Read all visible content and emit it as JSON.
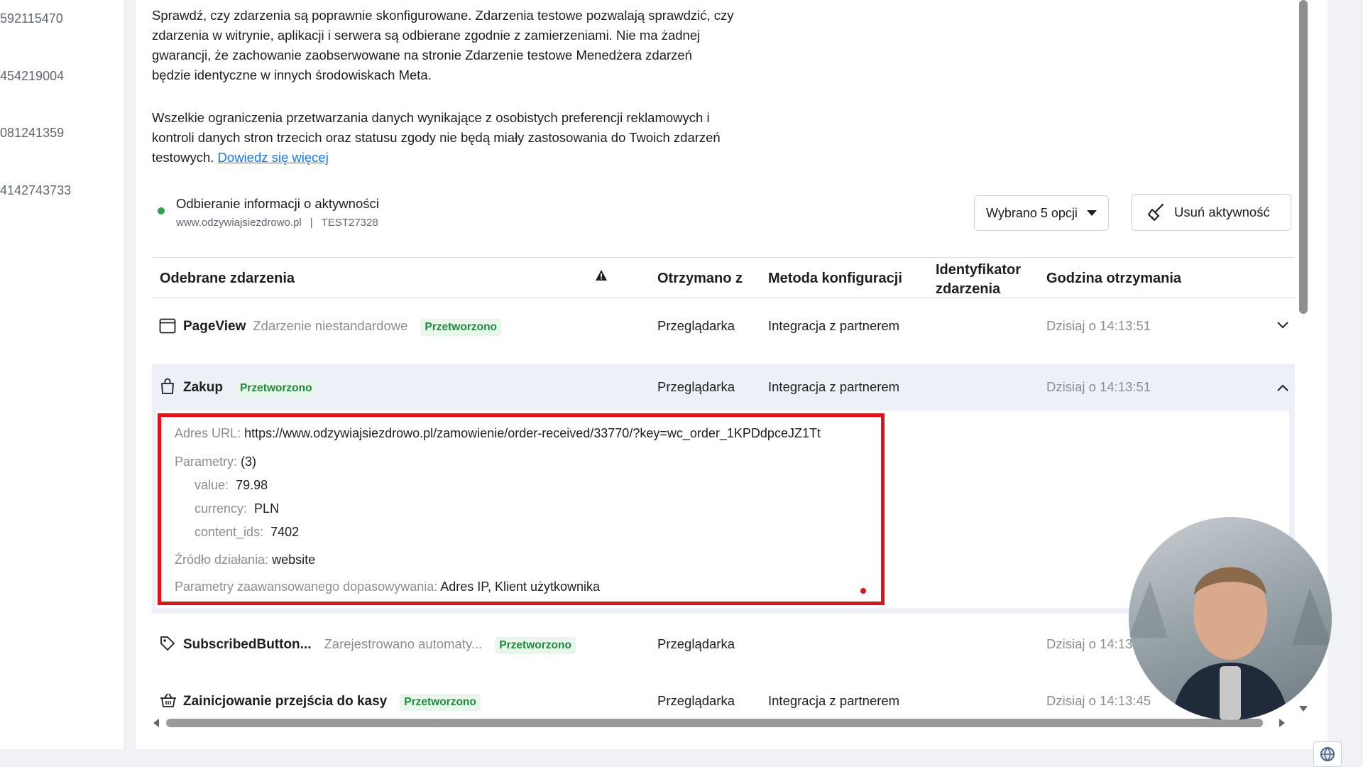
{
  "left_ids": [
    "592115470",
    "454219004",
    "081241359",
    "4142743733"
  ],
  "intro": {
    "para1": "Sprawdź, czy zdarzenia są poprawnie skonfigurowane. Zdarzenia testowe pozwalają sprawdzić, czy zdarzenia w witrynie, aplikacji i serwera są odbierane zgodnie z zamierzeniami. Nie ma żadnej gwarancji, że zachowanie zaobserwowane na stronie Zdarzenie testowe Menedżera zdarzeń będzie identyczne w innych środowiskach Meta.",
    "para2": "Wszelkie ograniczenia przetwarzania danych wynikające z osobistych preferencji reklamowych i kontroli danych stron trzecich oraz statusu zgody nie będą miały zastosowania do Twoich zdarzeń testowych.",
    "learn_more": "Dowiedz się więcej"
  },
  "status": {
    "title": "Odbieranie informacji o aktywności",
    "site": "www.odzywiajsiezdrowo.pl",
    "separator": "|",
    "code": "TEST27328",
    "color": "#31a24c"
  },
  "toolbar": {
    "filter_label": "Wybrano 5 opcji",
    "clear_label": "Usuń aktywność"
  },
  "table": {
    "headers": {
      "events": "Odebrane zdarzenia",
      "received_from": "Otrzymano z",
      "method": "Metoda konfiguracji",
      "event_id_line1": "Identyfikator",
      "event_id_line2": "zdarzenia",
      "time": "Godzina otrzymania"
    },
    "rows": [
      {
        "name": "PageView",
        "desc": "Zdarzenie niestandardowe",
        "status": "Przetworzono",
        "source": "Przeglądarka",
        "method": "Integracja z partnerem",
        "time": "Dzisiaj o 14:13:51",
        "icon": "browser-window-icon"
      },
      {
        "name": "Zakup",
        "desc": "",
        "status": "Przetworzono",
        "source": "Przeglądarka",
        "method": "Integracja z partnerem",
        "time": "Dzisiaj o 14:13:51",
        "icon": "shopping-bag-icon"
      },
      {
        "name": "SubscribedButton...",
        "desc": "Zarejestrowano automaty...",
        "status": "Przetworzono",
        "source": "Przeglądarka",
        "method": "",
        "time": "Dzisiaj o 14:13:",
        "icon": "tag-icon"
      },
      {
        "name": "Zainicjowanie przejścia do kasy",
        "desc": "",
        "status": "Przetworzono",
        "source": "Przeglądarka",
        "method": "Integracja z partnerem",
        "time": "Dzisiaj o 14:13:45",
        "icon": "basket-icon"
      }
    ],
    "details": {
      "url_label": "Adres URL:",
      "url_value": "https://www.odzywiajsiezdrowo.pl/zamowienie/order-received/33770/?key=wc_order_1KPDdpceJZ1Tt",
      "params_label": "Parametry:",
      "params_count": "(3)",
      "params": [
        {
          "key": "value:",
          "val": "79.98"
        },
        {
          "key": "currency:",
          "val": "PLN"
        },
        {
          "key": "content_ids:",
          "val": "7402"
        }
      ],
      "source_label": "Źródło działania:",
      "source_value": "website",
      "advanced_label": "Parametry zaawansowanego dopasowywania:",
      "advanced_value": "Adres IP, Klient użytkownika"
    }
  },
  "colors": {
    "accent": "#1877f2",
    "processed": "#1f8a3b",
    "highlight": "#e3111c"
  }
}
